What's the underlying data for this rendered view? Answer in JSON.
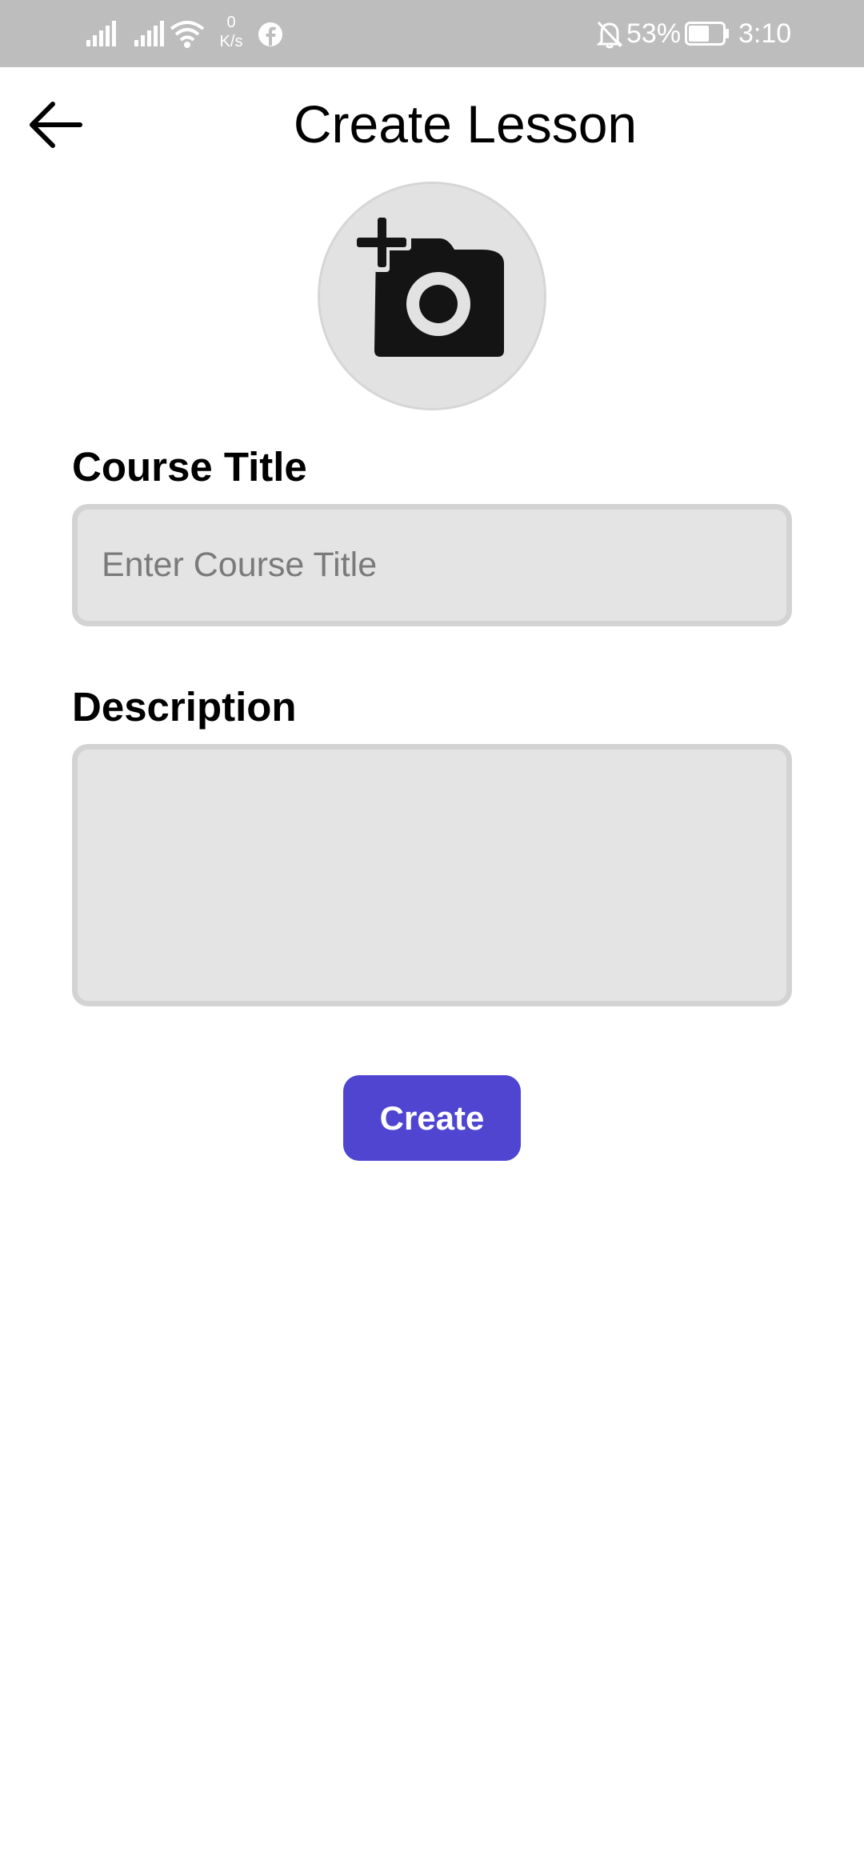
{
  "status_bar": {
    "net_speed_value": "0",
    "net_speed_unit": "K/s",
    "battery_percent": "53%",
    "time": "3:10",
    "icons": [
      "signal-icon",
      "signal-icon",
      "wifi-icon",
      "facebook-icon",
      "bell-off-icon",
      "battery-icon"
    ]
  },
  "header": {
    "title": "Create Lesson",
    "back_icon": "arrow-left-icon"
  },
  "photo_picker": {
    "icon": "add-photo-camera-icon"
  },
  "form": {
    "course_title_label": "Course Title",
    "course_title_value": "",
    "course_title_placeholder": "Enter Course Title",
    "description_label": "Description",
    "description_value": "",
    "create_label": "Create"
  },
  "colors": {
    "accent": "#4f45d1",
    "status_bar_bg": "#bdbdbd",
    "input_bg": "#e4e4e4",
    "input_border": "#d3d3d3"
  }
}
